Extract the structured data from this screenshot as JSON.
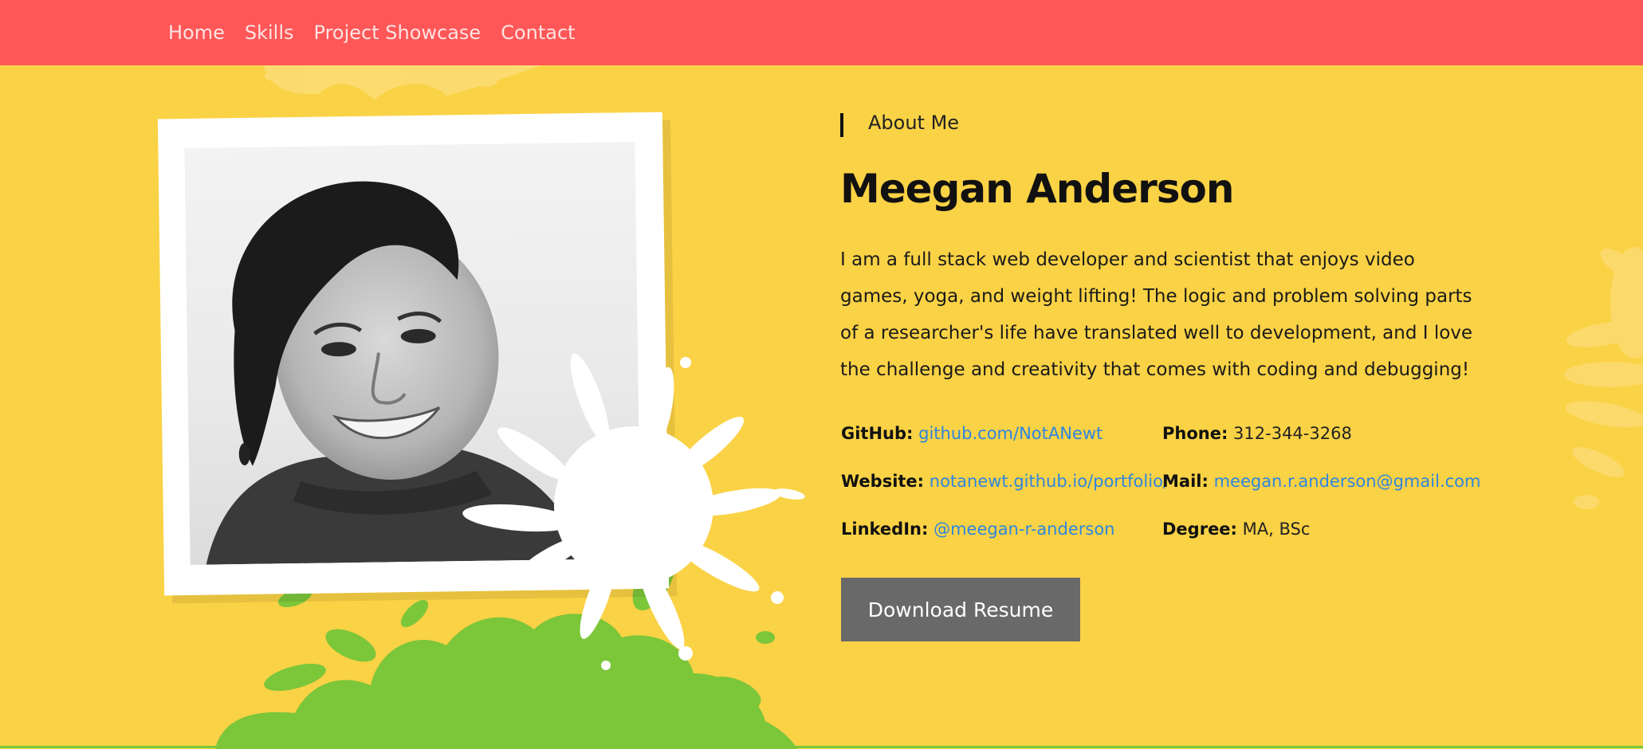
{
  "nav": {
    "items": [
      {
        "label": "Home"
      },
      {
        "label": "Skills"
      },
      {
        "label": "Project Showcase"
      },
      {
        "label": "Contact"
      }
    ]
  },
  "about": {
    "section_label": "About Me",
    "name": "Meegan Anderson",
    "bio": "I am a full stack web developer and scientist that enjoys video games, yoga, and weight lifting! The logic and problem solving parts of a researcher's life have translated well to development, and I love the challenge and creativity that comes with coding and debugging!",
    "details": {
      "github": {
        "label": "GitHub:",
        "value": "github.com/NotANewt"
      },
      "website": {
        "label": "Website:",
        "value": "notanewt.github.io/portfolio/"
      },
      "linkedin": {
        "label": "LinkedIn:",
        "value": "@meegan-r-anderson"
      },
      "phone": {
        "label": "Phone:",
        "value": "312-344-3268"
      },
      "mail": {
        "label": "Mail:",
        "value": "meegan.r.anderson@gmail.com"
      },
      "degree": {
        "label": "Degree:",
        "value": "MA, BSc"
      }
    },
    "download_label": "Download Resume"
  },
  "colors": {
    "nav_bg": "#ff5757",
    "page_bg": "#fad245",
    "link": "#2e86de",
    "button_bg": "#696969",
    "splat_green": "#7cc63a"
  }
}
